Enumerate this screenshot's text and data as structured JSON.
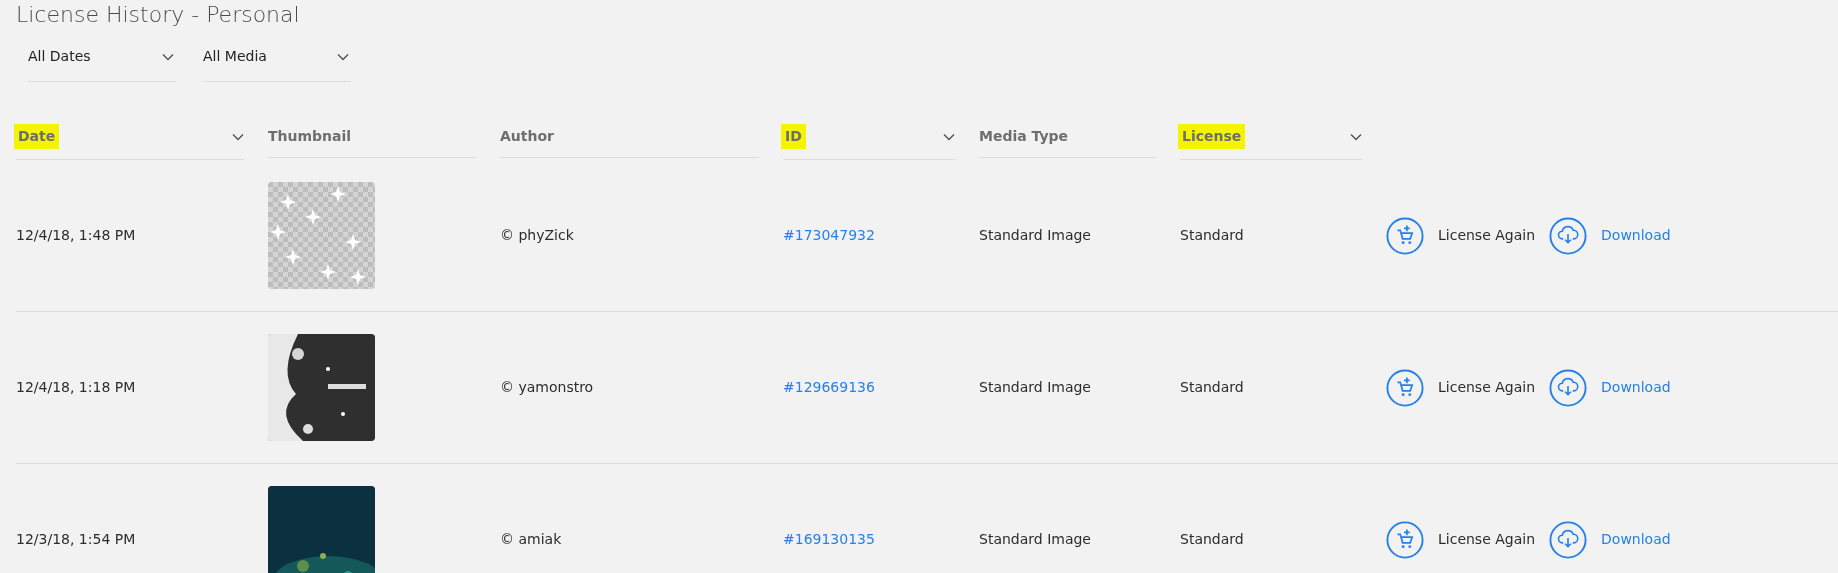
{
  "title": "License History - Personal",
  "filters": [
    {
      "label": "All Dates"
    },
    {
      "label": "All Media"
    }
  ],
  "columns": [
    {
      "label": "Date",
      "sortable": true,
      "highlighted": true
    },
    {
      "label": "Thumbnail",
      "sortable": false,
      "highlighted": false
    },
    {
      "label": "Author",
      "sortable": false,
      "highlighted": false
    },
    {
      "label": "ID",
      "sortable": true,
      "highlighted": true
    },
    {
      "label": "Media Type",
      "sortable": false,
      "highlighted": false
    },
    {
      "label": "License",
      "sortable": true,
      "highlighted": true
    }
  ],
  "rows": [
    {
      "date": "12/4/18, 1:48 PM",
      "thumbnail": {
        "kind": "sparkles"
      },
      "author": "© phyZick",
      "id": "#173047932",
      "media_type": "Standard Image",
      "license": "Standard",
      "license_again": "License Again",
      "download": "Download"
    },
    {
      "date": "12/4/18, 1:18 PM",
      "thumbnail": {
        "kind": "blizzard"
      },
      "author": "© yamonstro",
      "id": "#129669136",
      "media_type": "Standard Image",
      "license": "Standard",
      "license_again": "License Again",
      "download": "Download"
    },
    {
      "date": "12/3/18, 1:54 PM",
      "thumbnail": {
        "kind": "teal"
      },
      "author": "© amiak",
      "id": "#169130135",
      "media_type": "Standard Image",
      "license": "Standard",
      "license_again": "License Again",
      "download": "Download"
    }
  ]
}
